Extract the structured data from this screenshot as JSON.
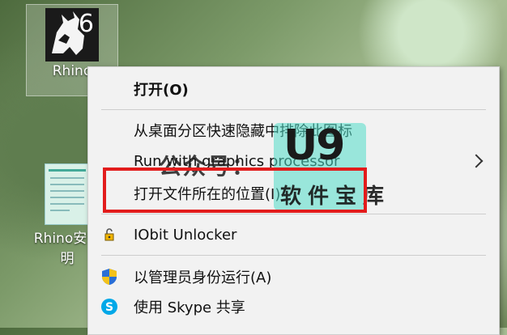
{
  "desktop": {
    "rhino_icon": {
      "label": "Rhino",
      "version": "6"
    },
    "doc_icon": {
      "label_line1": "Rhino安装",
      "label_line2": "明"
    }
  },
  "menu": {
    "open": "打开(O)",
    "unpin": "从桌面分区快速隐藏中排除此图标",
    "run_graphics": "Run with graphics processor",
    "open_location": "打开文件所在的位置(I)",
    "iobit": "IObit Unlocker",
    "run_admin": "以管理员身份运行(A)",
    "skype_share": "使用 Skype 共享"
  },
  "watermark": {
    "brand": "U9",
    "left_text": "公众号：",
    "bottom_text": "软件宝库"
  },
  "colors": {
    "highlight": "#e21c1c",
    "menu_bg": "#f2f2f2"
  },
  "icons": {
    "open_location": "none",
    "iobit": "lock-icon",
    "run_admin": "uac-shield-icon",
    "skype_share": "skype-icon",
    "submenu": "chevron-right-icon"
  }
}
